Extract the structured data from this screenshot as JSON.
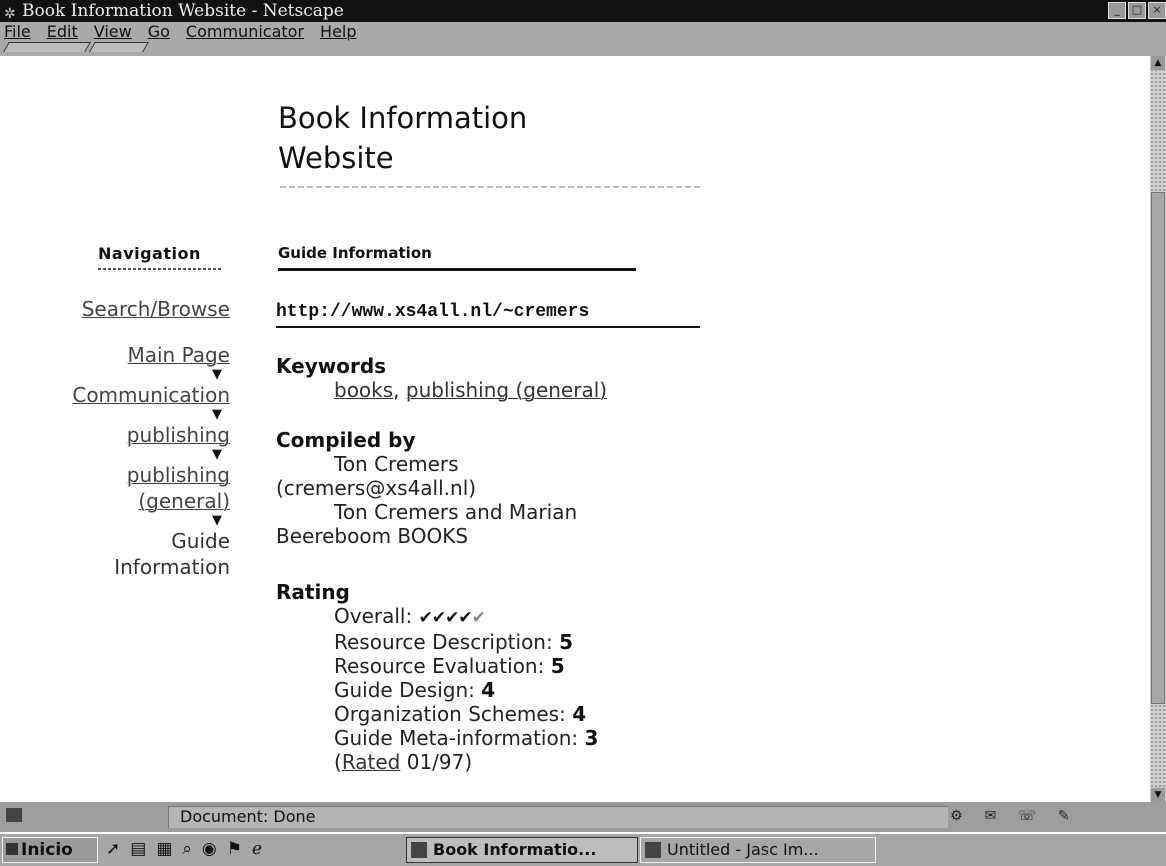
{
  "window": {
    "title": "Book Information Website - Netscape",
    "controls": [
      "_",
      "□",
      "×"
    ]
  },
  "menu": [
    "File",
    "Edit",
    "View",
    "Go",
    "Communicator",
    "Help"
  ],
  "page": {
    "title_line1": "Book Information",
    "title_line2": "Website"
  },
  "nav": {
    "heading": "Navigation",
    "items": [
      {
        "label": "Search/Browse",
        "link": true
      },
      {
        "label": "Main Page",
        "link": true
      },
      {
        "label": "Communication",
        "link": true
      },
      {
        "label": "publishing",
        "link": true
      },
      {
        "label": "publishing (general)",
        "link": true
      },
      {
        "label": "Guide Information",
        "link": false
      }
    ]
  },
  "guide": {
    "heading": "Guide Information",
    "url": "http://www.xs4all.nl/~cremers",
    "keywords_heading": "Keywords",
    "keywords": [
      "books",
      "publishing (general)"
    ],
    "compiled_heading": "Compiled by",
    "compiled_line1": "Ton Cremers",
    "compiled_line2": "(cremers@xs4all.nl)",
    "compiled_line3": "Ton Cremers and Marian",
    "compiled_line4": "Beereboom BOOKS",
    "rating_heading": "Rating",
    "overall_label": "Overall:",
    "overall_rating": 4,
    "overall_max": 5,
    "ratings": [
      {
        "label": "Resource Description:",
        "value": "5"
      },
      {
        "label": "Resource Evaluation:",
        "value": "5"
      },
      {
        "label": "Guide Design:",
        "value": "4"
      },
      {
        "label": "Organization Schemes:",
        "value": "4"
      },
      {
        "label": "Guide Meta-information:",
        "value": "3"
      }
    ],
    "rated_prefix": "(",
    "rated_link": "Rated",
    "rated_date": " 01/97)"
  },
  "status": {
    "text": "Document: Done"
  },
  "taskbar": {
    "start_label": "Inicio",
    "tasks": [
      "Book Informatio...",
      "Untitled - Jasc Im..."
    ]
  }
}
